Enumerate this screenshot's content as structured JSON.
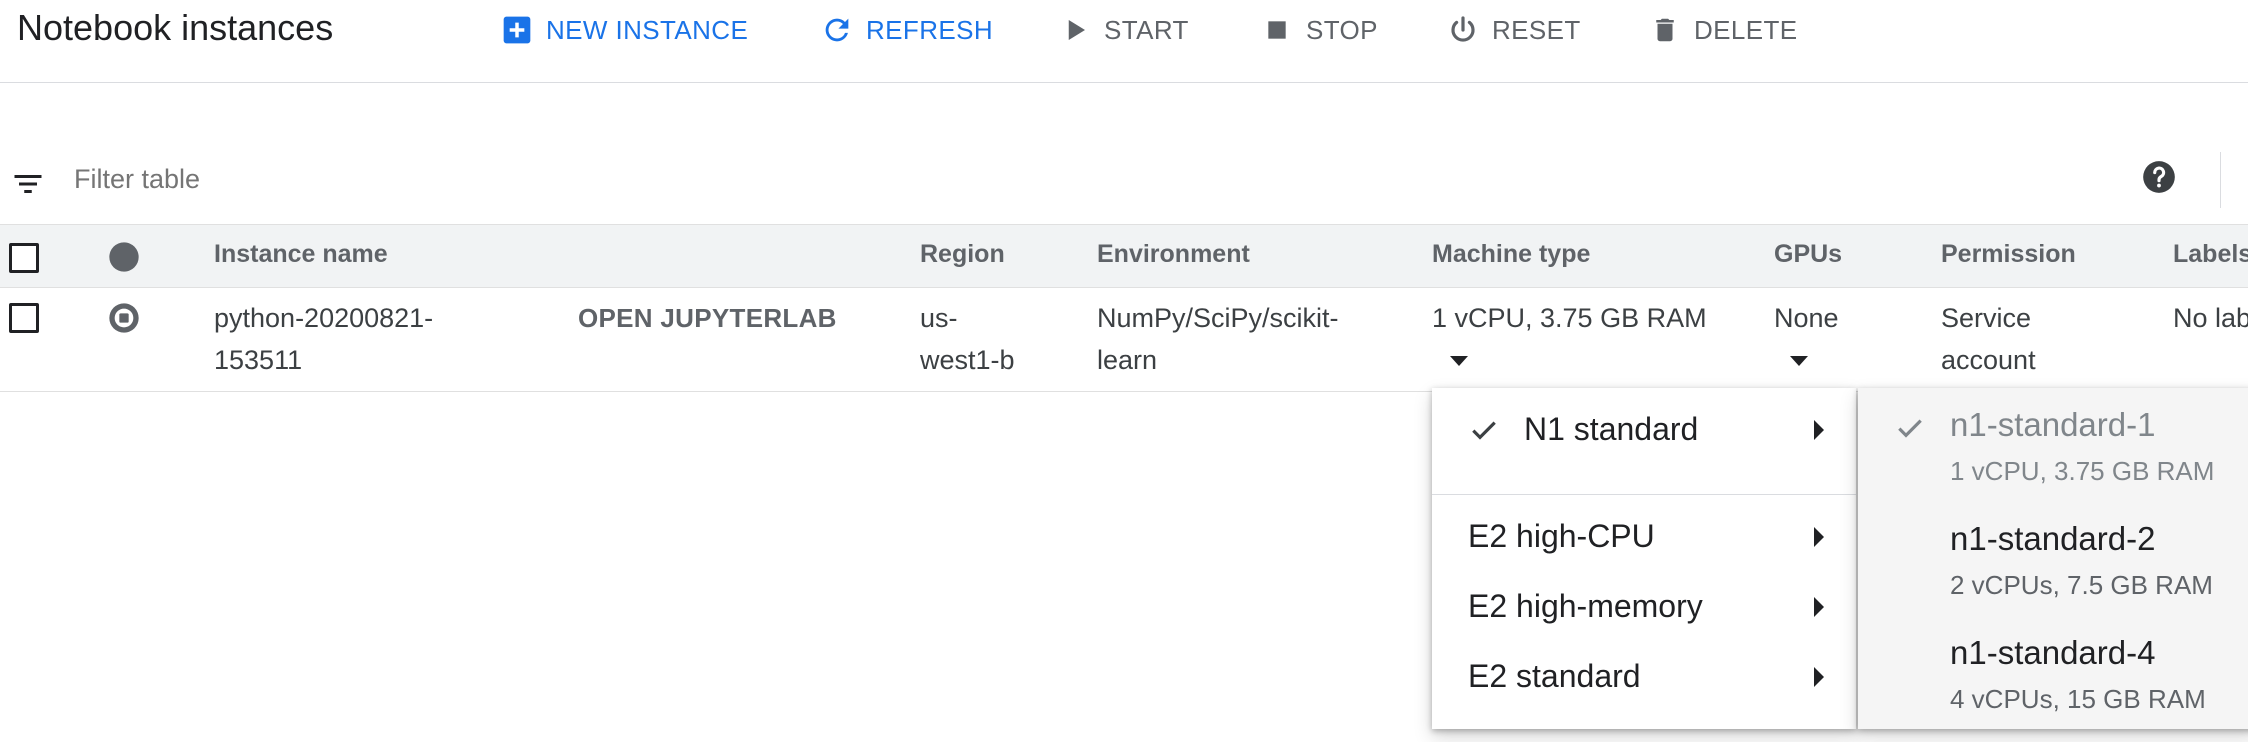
{
  "header": {
    "title": "Notebook instances",
    "actions": [
      {
        "label": "NEW INSTANCE",
        "icon": "add-box-icon",
        "state": "active"
      },
      {
        "label": "REFRESH",
        "icon": "refresh-icon",
        "state": "active"
      },
      {
        "label": "START",
        "icon": "play-icon",
        "state": "disabled"
      },
      {
        "label": "STOP",
        "icon": "stop-icon",
        "state": "disabled"
      },
      {
        "label": "RESET",
        "icon": "power-icon",
        "state": "disabled"
      },
      {
        "label": "DELETE",
        "icon": "trash-icon",
        "state": "disabled"
      }
    ]
  },
  "filter": {
    "placeholder": "Filter table",
    "icon": "filter-list-icon",
    "help_icon": "help-icon"
  },
  "table": {
    "columns": [
      "Instance name",
      "Region",
      "Environment",
      "Machine type",
      "GPUs",
      "Permission",
      "Labels"
    ],
    "rows": [
      {
        "instance_name_line1": "python-20200821-",
        "instance_name_line2": "153511",
        "open_link": "OPEN JUPYTERLAB",
        "region_line1": "us-",
        "region_line2": "west1-b",
        "environment_line1": "NumPy/SciPy/scikit-",
        "environment_line2": "learn",
        "machine_type": "1 vCPU, 3.75 GB RAM",
        "gpus": "None",
        "permission_line1": "Service",
        "permission_line2": "account",
        "labels": "No lab"
      }
    ]
  },
  "machine_family_menu": {
    "items": [
      {
        "label": "N1 standard",
        "checked": true
      },
      {
        "label": "E2 high-CPU",
        "checked": false
      },
      {
        "label": "E2 high-memory",
        "checked": false
      },
      {
        "label": "E2 standard",
        "checked": false
      }
    ]
  },
  "machine_type_menu": {
    "items": [
      {
        "name": "n1-standard-1",
        "spec": "1 vCPU, 3.75 GB RAM",
        "selected": true
      },
      {
        "name": "n1-standard-2",
        "spec": "2 vCPUs, 7.5 GB RAM",
        "selected": false
      },
      {
        "name": "n1-standard-4",
        "spec": "4 vCPUs, 15 GB RAM",
        "selected": false
      }
    ]
  },
  "colors": {
    "accent": "#1a73e8",
    "muted": "#5f6368",
    "header_bg": "#f1f3f4"
  }
}
